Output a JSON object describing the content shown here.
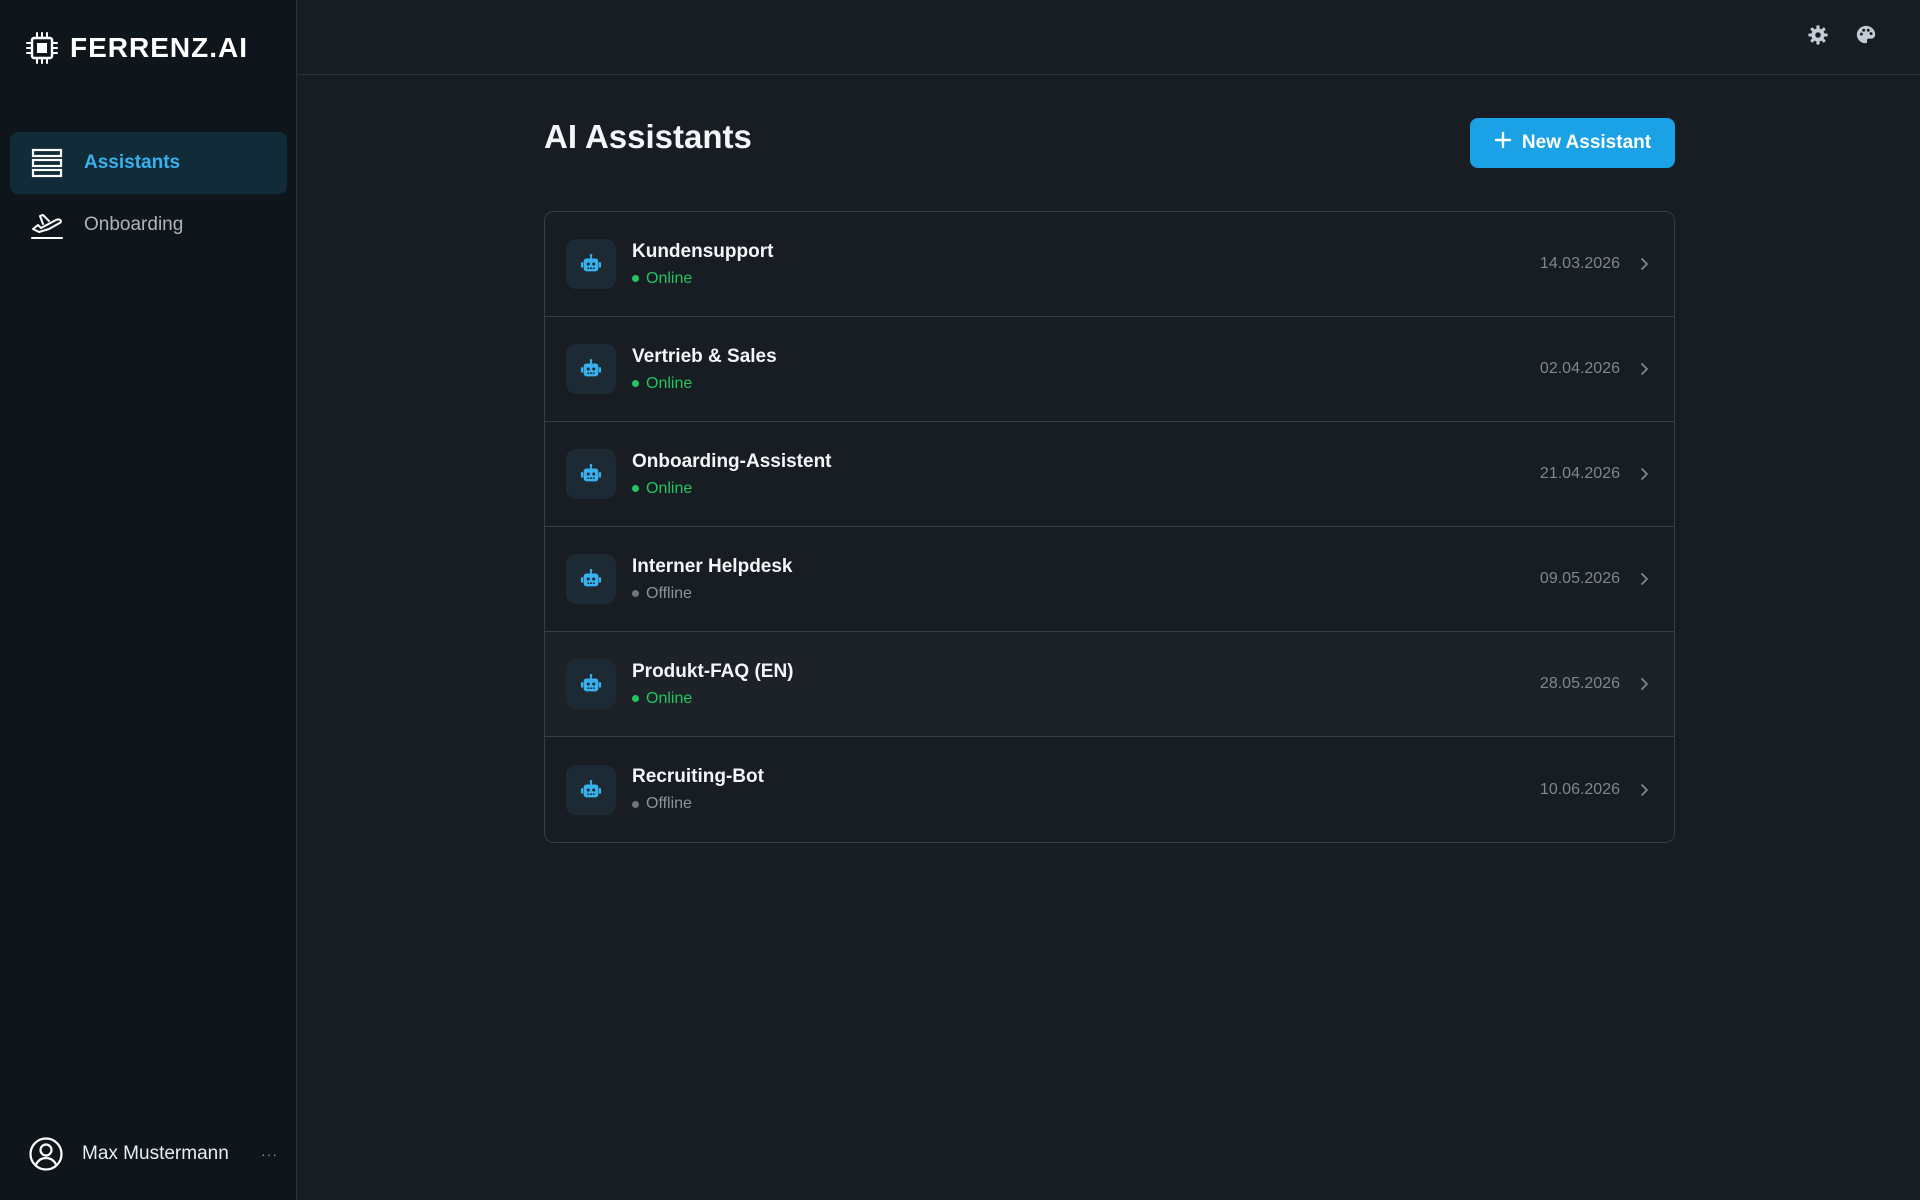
{
  "app": {
    "brand": "FERRENZ.AI"
  },
  "sidebar": {
    "items": [
      {
        "label": "Assistants",
        "icon": "list-icon",
        "active": true
      },
      {
        "label": "Onboarding",
        "icon": "plane-departure-icon",
        "active": false
      }
    ],
    "user": {
      "name": "Max Mustermann",
      "more": "···"
    }
  },
  "topbar": {
    "settings_icon": "gear-icon",
    "theme_icon": "palette-icon"
  },
  "main": {
    "title": "AI Assistants",
    "new_button_label": "New Assistant",
    "assistants": [
      {
        "name": "Kundensupport",
        "status": "Online",
        "date": "14.03.2026"
      },
      {
        "name": "Vertrieb & Sales",
        "status": "Online",
        "date": "02.04.2026"
      },
      {
        "name": "Onboarding-Assistent",
        "status": "Online",
        "date": "21.04.2026"
      },
      {
        "name": "Interner Helpdesk",
        "status": "Offline",
        "date": "09.05.2026"
      },
      {
        "name": "Produkt-FAQ (EN)",
        "status": "Online",
        "date": "28.05.2026"
      },
      {
        "name": "Recruiting-Bot",
        "status": "Offline",
        "date": "10.06.2026"
      }
    ]
  },
  "colors": {
    "accent": "#1aa1e6",
    "online": "#22c55e",
    "offline": "#8a949d",
    "background": "#171d22",
    "sidebar": "#0e161c"
  }
}
